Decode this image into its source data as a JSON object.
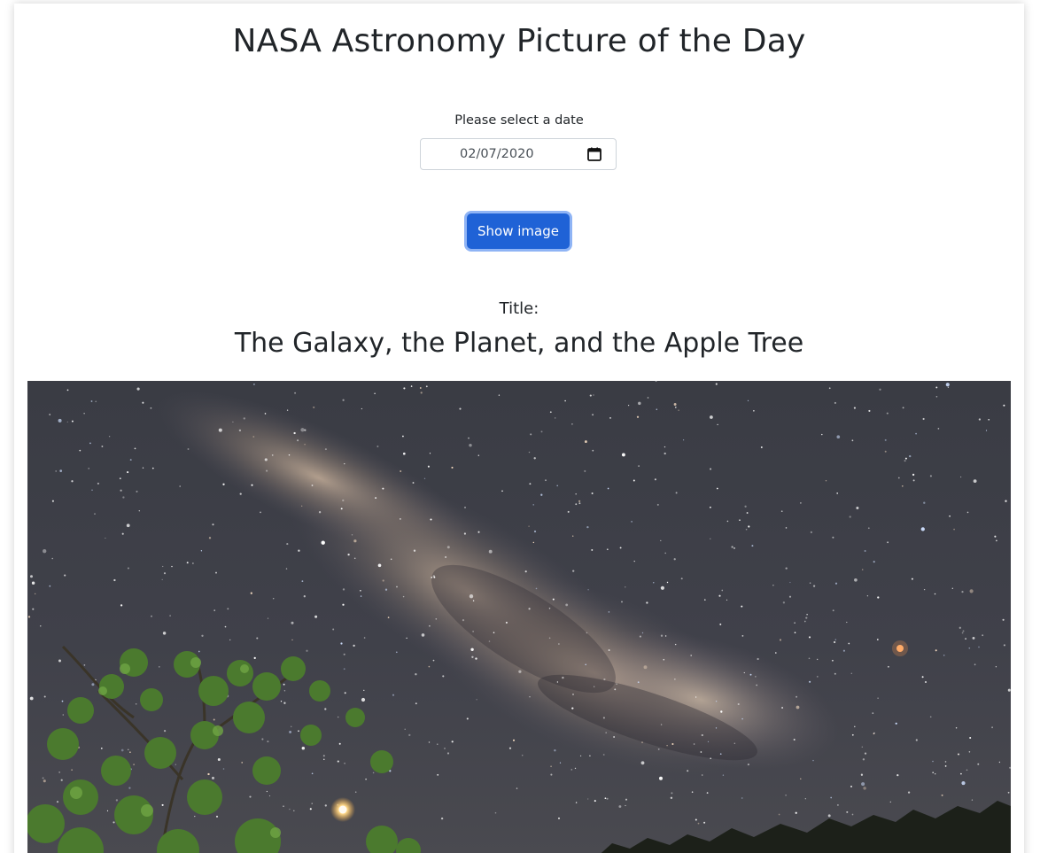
{
  "page": {
    "heading": "NASA Astronomy Picture of the Day"
  },
  "date_picker": {
    "label": "Please select a date",
    "value": "02/07/2020",
    "icon": "calendar-icon"
  },
  "actions": {
    "show_image_label": "Show image"
  },
  "result": {
    "title_label": "Title:",
    "title": "The Galaxy, the Planet, and the Apple Tree"
  },
  "colors": {
    "button": "#1f62d6",
    "button_focus_ring": "#8fb4f5",
    "text": "#212529"
  }
}
